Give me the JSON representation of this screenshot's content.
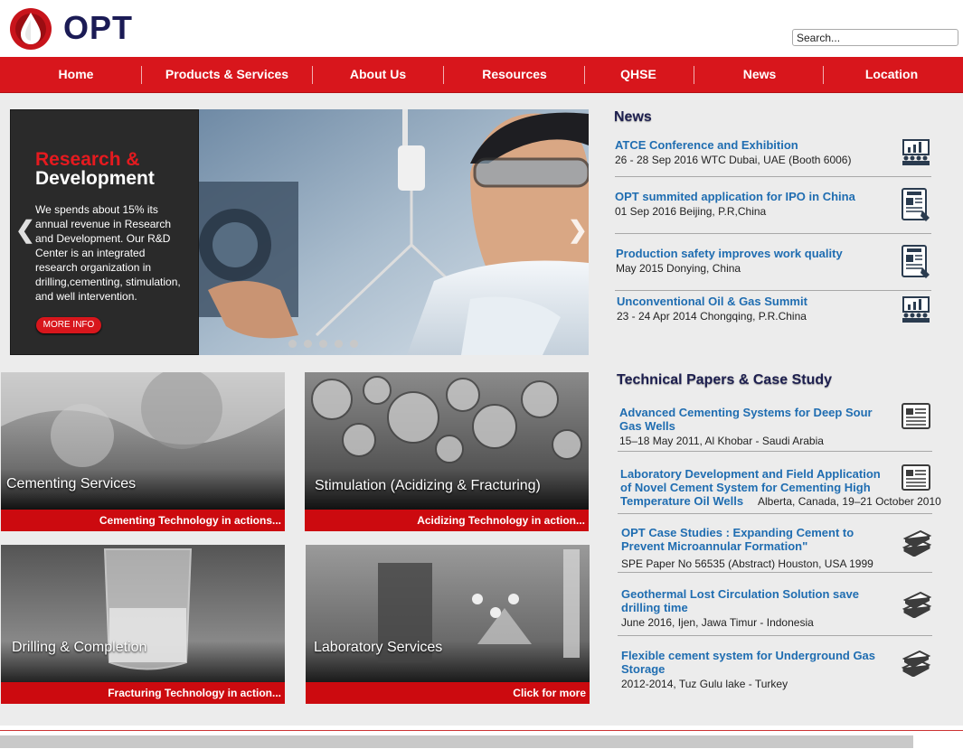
{
  "brand": {
    "name": "OPT"
  },
  "search": {
    "placeholder": "Search..."
  },
  "nav": [
    {
      "label": "Home"
    },
    {
      "label": "Products & Services"
    },
    {
      "label": "About Us"
    },
    {
      "label": "Resources"
    },
    {
      "label": "QHSE"
    },
    {
      "label": "News"
    },
    {
      "label": "Location"
    }
  ],
  "slider": {
    "title_line1": "Research &",
    "title_line2": "Development",
    "text": "We spends about 15% its annual revenue in Research and Development. Our R&D Center is an integrated research organization in drilling,cementing, stimulation, and well intervention.",
    "more_label": "MORE INFO",
    "slide_count": 5
  },
  "tiles": [
    {
      "label": "Cementing Services",
      "bar": "Cementing Technology in actions..."
    },
    {
      "label": "Stimulation (Acidizing & Fracturing)",
      "bar": "Acidizing Technology in action..."
    },
    {
      "label": "Drilling & Completion",
      "bar": "Fracturing Technology in action..."
    },
    {
      "label": "Laboratory Services",
      "bar": "Click for more"
    }
  ],
  "news": {
    "title": "News",
    "items": [
      {
        "title": "ATCE Conference and Exhibition",
        "sub": "26 - 28 Sep 2016 WTC Dubai, UAE (Booth 6006)",
        "icon": "conference-icon"
      },
      {
        "title": "OPT summited application for IPO in China",
        "sub": "01 Sep 2016 Beijing, P.R,China",
        "icon": "news-tablet-icon"
      },
      {
        "title": "Production safety improves work quality",
        "sub": "May 2015 Donying, China",
        "icon": "news-tablet-icon"
      },
      {
        "title": "Unconventional Oil & Gas Summit",
        "sub": "23 - 24 Apr 2014 Chongqing, P.R.China",
        "icon": "conference-icon"
      }
    ]
  },
  "papers": {
    "title": "Technical Papers & Case Study",
    "items": [
      {
        "title": "Advanced Cementing Systems for Deep Sour Gas Wells",
        "sub": "15–18 May 2011, Al Khobar - Saudi Arabia",
        "icon": "document-icon"
      },
      {
        "title": "Laboratory Development and Field Application of Novel Cement System for Cementing High Temperature Oil Wells",
        "sub": "Alberta, Canada, 19–21 October 2010",
        "icon": "document-icon"
      },
      {
        "title": "OPT Case Studies : Expanding Cement to Prevent Microannular Formation\"",
        "sub": "SPE Paper No 56535 (Abstract) Houston, USA 1999",
        "icon": "books-icon"
      },
      {
        "title": "Geothermal Lost Circulation Solution save drilling time",
        "sub": "June 2016, Ijen, Jawa Timur - Indonesia",
        "icon": "books-icon"
      },
      {
        "title": "Flexible cement system for Underground Gas Storage",
        "sub": "2012-2014, Tuz Gulu lake - Turkey",
        "icon": "books-icon"
      }
    ]
  }
}
